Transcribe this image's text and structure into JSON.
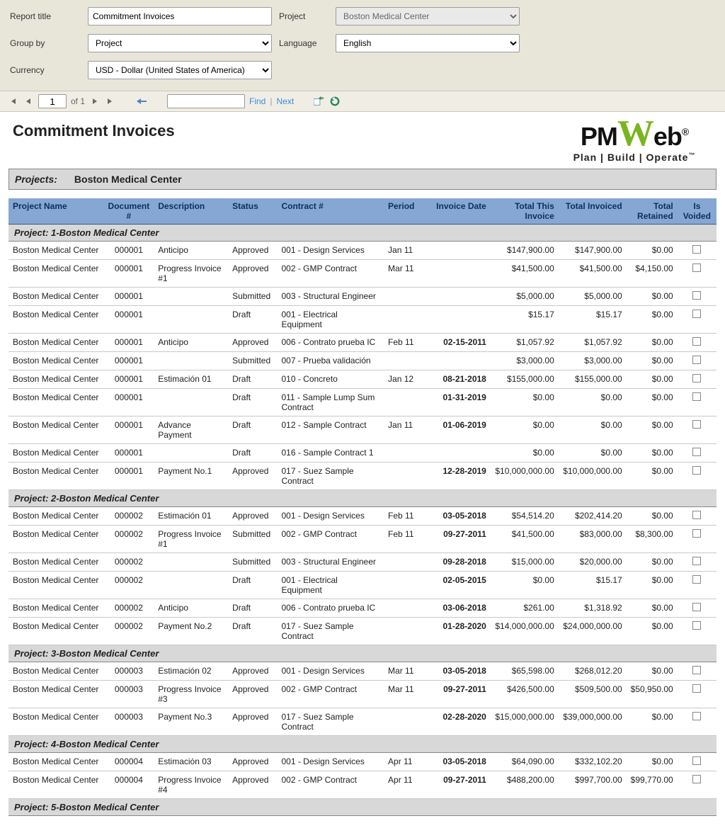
{
  "filters": {
    "report_title_label": "Report title",
    "report_title_value": "Commitment Invoices",
    "project_label": "Project",
    "project_value": "Boston Medical Center",
    "group_by_label": "Group by",
    "group_by_value": "Project",
    "language_label": "Language",
    "language_value": "English",
    "currency_label": "Currency",
    "currency_value": "USD - Dollar (United States of America)"
  },
  "toolbar": {
    "page": "1",
    "of_label": "of 1",
    "find_label": "Find",
    "next_label": "Next"
  },
  "header": {
    "title": "Commitment Invoices",
    "logo_pm": "PM",
    "logo_w": "W",
    "logo_eb": "eb",
    "logo_reg": "®",
    "tagline": "Plan | Build | Operate",
    "tm": "™"
  },
  "banner": {
    "label": "Projects:",
    "value": "Boston Medical Center"
  },
  "columns": {
    "project_name": "Project Name",
    "document_no": "Document #",
    "description": "Description",
    "status": "Status",
    "contract_no": "Contract #",
    "period": "Period",
    "invoice_date": "Invoice Date",
    "total_this_invoice": "Total This Invoice",
    "total_invoiced": "Total Invoiced",
    "total_retained": "Total Retained",
    "is_voided": "Is Voided"
  },
  "groups": [
    {
      "label": "Project:  1-Boston Medical Center",
      "rows": [
        {
          "project": "Boston Medical Center",
          "doc": "000001",
          "desc": "Anticipo",
          "status": "Approved",
          "contract": "001 - Design Services",
          "period": "Jan 11",
          "invdate": "",
          "thisinv": "$147,900.00",
          "totinv": "$147,900.00",
          "retained": "$0.00"
        },
        {
          "project": "Boston Medical Center",
          "doc": "000001",
          "desc": "Progress Invoice #1",
          "status": "Approved",
          "contract": "002 - GMP Contract",
          "period": "Mar 11",
          "invdate": "",
          "thisinv": "$41,500.00",
          "totinv": "$41,500.00",
          "retained": "$4,150.00"
        },
        {
          "project": "Boston Medical Center",
          "doc": "000001",
          "desc": "",
          "status": "Submitted",
          "contract": "003 - Structural Engineer",
          "period": "",
          "invdate": "",
          "thisinv": "$5,000.00",
          "totinv": "$5,000.00",
          "retained": "$0.00"
        },
        {
          "project": "Boston Medical Center",
          "doc": "000001",
          "desc": "",
          "status": "Draft",
          "contract": "001 - Electrical Equipment",
          "period": "",
          "invdate": "",
          "thisinv": "$15.17",
          "totinv": "$15.17",
          "retained": "$0.00"
        },
        {
          "project": "Boston Medical Center",
          "doc": "000001",
          "desc": "Anticipo",
          "status": "Approved",
          "contract": "006 - Contrato prueba IC",
          "period": "Feb 11",
          "invdate": "02-15-2011",
          "thisinv": "$1,057.92",
          "totinv": "$1,057.92",
          "retained": "$0.00"
        },
        {
          "project": "Boston Medical Center",
          "doc": "000001",
          "desc": "",
          "status": "Submitted",
          "contract": "007 - Prueba validación",
          "period": "",
          "invdate": "",
          "thisinv": "$3,000.00",
          "totinv": "$3,000.00",
          "retained": "$0.00"
        },
        {
          "project": "Boston Medical Center",
          "doc": "000001",
          "desc": "Estimación 01",
          "status": "Draft",
          "contract": "010 - Concreto",
          "period": "Jan 12",
          "invdate": "08-21-2018",
          "thisinv": "$155,000.00",
          "totinv": "$155,000.00",
          "retained": "$0.00"
        },
        {
          "project": "Boston Medical Center",
          "doc": "000001",
          "desc": "",
          "status": "Draft",
          "contract": "011 - Sample Lump Sum Contract",
          "period": "",
          "invdate": "01-31-2019",
          "thisinv": "$0.00",
          "totinv": "$0.00",
          "retained": "$0.00"
        },
        {
          "project": "Boston Medical Center",
          "doc": "000001",
          "desc": "Advance Payment",
          "status": "Draft",
          "contract": "012 - Sample Contract",
          "period": "Jan 11",
          "invdate": "01-06-2019",
          "thisinv": "$0.00",
          "totinv": "$0.00",
          "retained": "$0.00"
        },
        {
          "project": "Boston Medical Center",
          "doc": "000001",
          "desc": "",
          "status": "Draft",
          "contract": "016 - Sample Contract 1",
          "period": "",
          "invdate": "",
          "thisinv": "$0.00",
          "totinv": "$0.00",
          "retained": "$0.00"
        },
        {
          "project": "Boston Medical Center",
          "doc": "000001",
          "desc": "Payment No.1",
          "status": "Approved",
          "contract": "017 - Suez Sample Contract",
          "period": "",
          "invdate": "12-28-2019",
          "thisinv": "$10,000,000.00",
          "totinv": "$10,000,000.00",
          "retained": "$0.00"
        }
      ]
    },
    {
      "label": "Project:  2-Boston Medical Center",
      "rows": [
        {
          "project": "Boston Medical Center",
          "doc": "000002",
          "desc": "Estimación 01",
          "status": "Approved",
          "contract": "001 - Design Services",
          "period": "Feb 11",
          "invdate": "03-05-2018",
          "thisinv": "$54,514.20",
          "totinv": "$202,414.20",
          "retained": "$0.00"
        },
        {
          "project": "Boston Medical Center",
          "doc": "000002",
          "desc": "Progress Invoice #1",
          "status": "Submitted",
          "contract": "002 - GMP Contract",
          "period": "Feb 11",
          "invdate": "09-27-2011",
          "thisinv": "$41,500.00",
          "totinv": "$83,000.00",
          "retained": "$8,300.00"
        },
        {
          "project": "Boston Medical Center",
          "doc": "000002",
          "desc": "",
          "status": "Submitted",
          "contract": "003 - Structural Engineer",
          "period": "",
          "invdate": "09-28-2018",
          "thisinv": "$15,000.00",
          "totinv": "$20,000.00",
          "retained": "$0.00"
        },
        {
          "project": "Boston Medical Center",
          "doc": "000002",
          "desc": "",
          "status": "Draft",
          "contract": "001 - Electrical Equipment",
          "period": "",
          "invdate": "02-05-2015",
          "thisinv": "$0.00",
          "totinv": "$15.17",
          "retained": "$0.00"
        },
        {
          "project": "Boston Medical Center",
          "doc": "000002",
          "desc": "Anticipo",
          "status": "Draft",
          "contract": "006 - Contrato prueba IC",
          "period": "",
          "invdate": "03-06-2018",
          "thisinv": "$261.00",
          "totinv": "$1,318.92",
          "retained": "$0.00"
        },
        {
          "project": "Boston Medical Center",
          "doc": "000002",
          "desc": "Payment No.2",
          "status": "Draft",
          "contract": "017 - Suez Sample Contract",
          "period": "",
          "invdate": "01-28-2020",
          "thisinv": "$14,000,000.00",
          "totinv": "$24,000,000.00",
          "retained": "$0.00"
        }
      ]
    },
    {
      "label": "Project:  3-Boston Medical Center",
      "rows": [
        {
          "project": "Boston Medical Center",
          "doc": "000003",
          "desc": "Estimación 02",
          "status": "Approved",
          "contract": "001 - Design Services",
          "period": "Mar 11",
          "invdate": "03-05-2018",
          "thisinv": "$65,598.00",
          "totinv": "$268,012.20",
          "retained": "$0.00"
        },
        {
          "project": "Boston Medical Center",
          "doc": "000003",
          "desc": "Progress Invoice #3",
          "status": "Approved",
          "contract": "002 - GMP Contract",
          "period": "Mar 11",
          "invdate": "09-27-2011",
          "thisinv": "$426,500.00",
          "totinv": "$509,500.00",
          "retained": "$50,950.00"
        },
        {
          "project": "Boston Medical Center",
          "doc": "000003",
          "desc": "Payment No.3",
          "status": "Approved",
          "contract": "017 - Suez Sample Contract",
          "period": "",
          "invdate": "02-28-2020",
          "thisinv": "$15,000,000.00",
          "totinv": "$39,000,000.00",
          "retained": "$0.00"
        }
      ]
    },
    {
      "label": "Project:  4-Boston Medical Center",
      "rows": [
        {
          "project": "Boston Medical Center",
          "doc": "000004",
          "desc": "Estimación 03",
          "status": "Approved",
          "contract": "001 - Design Services",
          "period": "Apr 11",
          "invdate": "03-05-2018",
          "thisinv": "$64,090.00",
          "totinv": "$332,102.20",
          "retained": "$0.00"
        },
        {
          "project": "Boston Medical Center",
          "doc": "000004",
          "desc": "Progress Invoice #4",
          "status": "Approved",
          "contract": "002 - GMP Contract",
          "period": "Apr 11",
          "invdate": "09-27-2011",
          "thisinv": "$488,200.00",
          "totinv": "$997,700.00",
          "retained": "$99,770.00"
        }
      ]
    },
    {
      "label": "Project:  5-Boston Medical Center",
      "rows": []
    }
  ]
}
